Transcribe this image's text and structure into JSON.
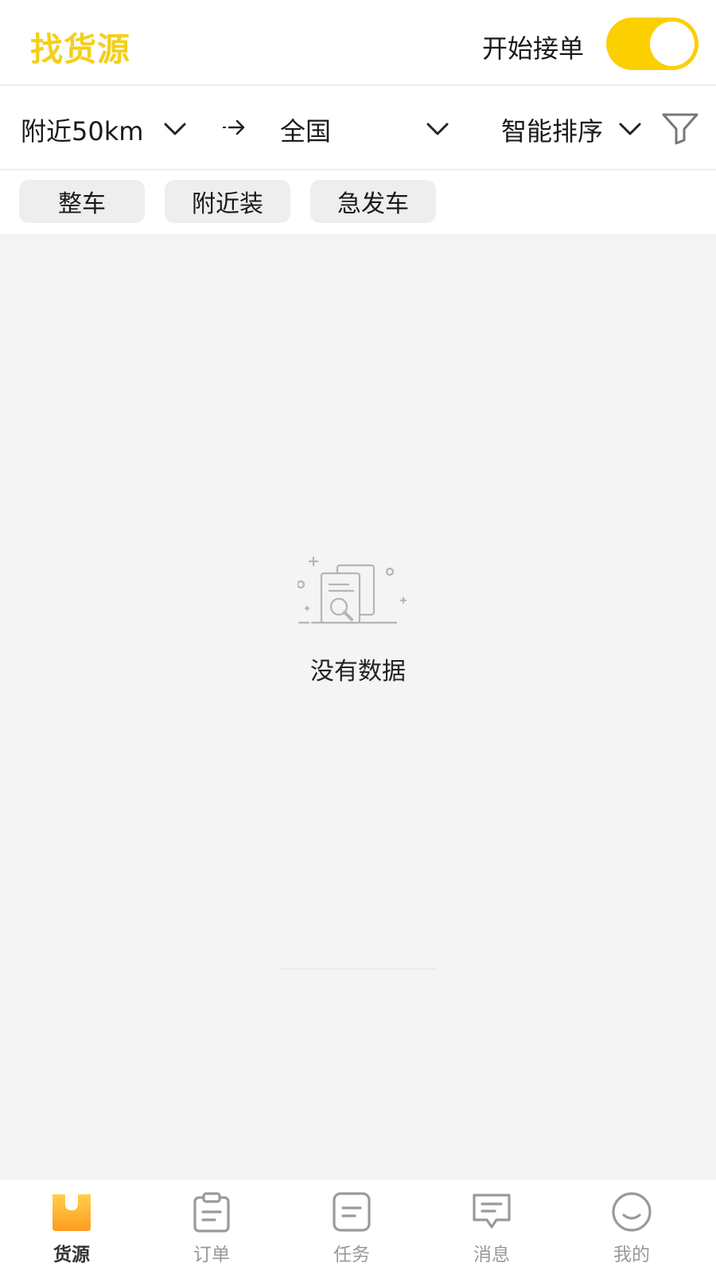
{
  "header": {
    "title": "找货源",
    "accept_orders_label": "开始接单",
    "accept_orders_on": true
  },
  "filters": {
    "origin": "附近50km",
    "destination": "全国",
    "sort": "智能排序"
  },
  "chips": [
    "整车",
    "附近装",
    "急发车"
  ],
  "content": {
    "empty_text": "没有数据"
  },
  "tabbar": {
    "active_index": 0,
    "tabs": [
      {
        "label": "货源",
        "icon": "cargo-icon"
      },
      {
        "label": "订单",
        "icon": "clipboard-icon"
      },
      {
        "label": "任务",
        "icon": "task-icon"
      },
      {
        "label": "消息",
        "icon": "message-icon"
      },
      {
        "label": "我的",
        "icon": "smiley-icon"
      }
    ]
  },
  "colors": {
    "accent": "#fccf00",
    "title": "#f4cf1a",
    "content_bg": "#f4f4f4",
    "chip_bg": "#eeeeee"
  }
}
